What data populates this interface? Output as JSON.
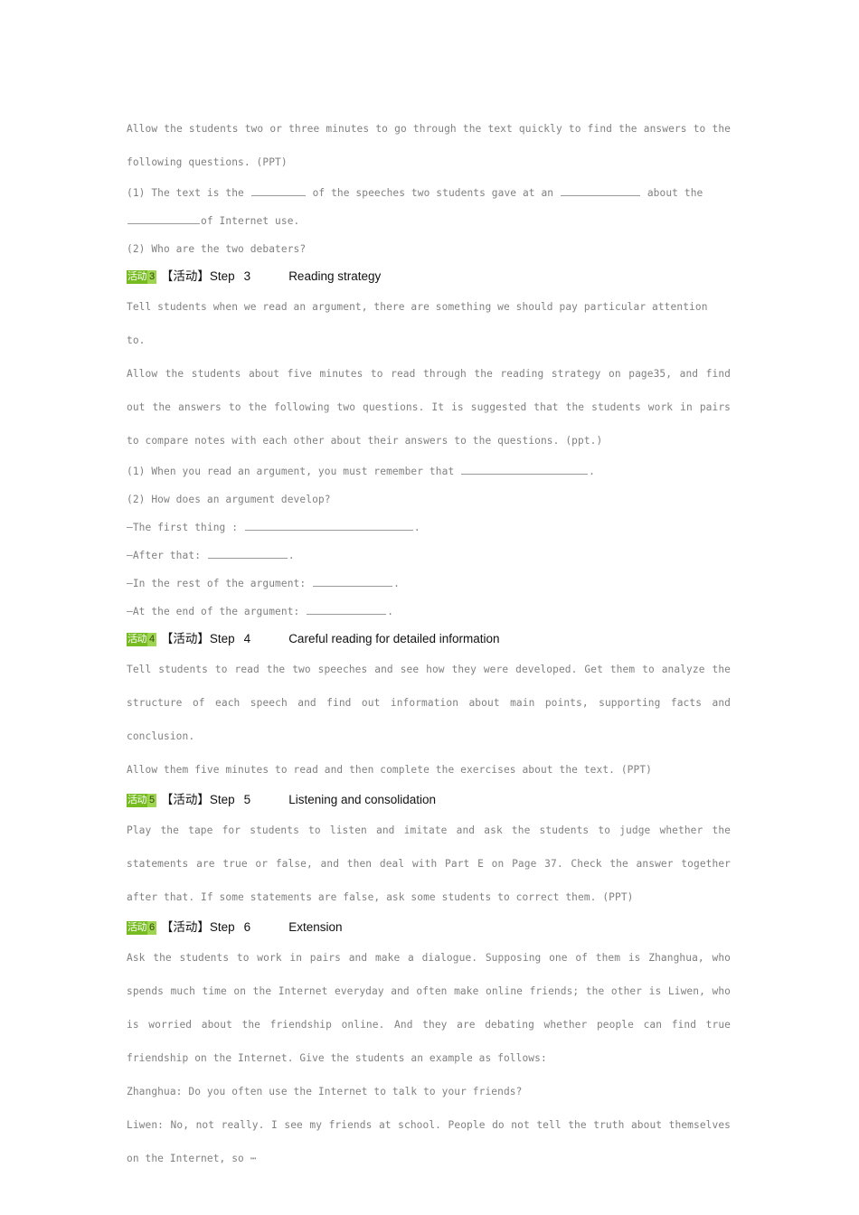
{
  "document": {
    "page_background": "#ffffff",
    "body_text_color": "#808080",
    "heading_text_color": "#111111",
    "badge_color_primary": "#76bc21",
    "badge_color_secondary": "#9ed44f"
  },
  "intro": {
    "p1": "Allow the students two or three minutes to go through the text quickly to find the answers to the following questions. (PPT)",
    "q1_a": "(1) The text is the",
    "q1_b": "of the speeches two students gave at an",
    "q1_c": "about the",
    "q1_d": "of Internet use.",
    "q2": "(2) Who are the two debaters?"
  },
  "steps": [
    {
      "badge_cn": "活动",
      "badge_num": "3",
      "bracket": "【活动】",
      "step_label": "Step",
      "step_num": "3",
      "title": "Reading   strategy",
      "paragraphs": [
        "Tell students when we read an argument, there are something we should pay particular attention to.",
        "Allow the students about five minutes to read through the reading strategy on page35, and find out the answers to the following two questions. It is suggested that the students work in pairs to compare notes with each other about their answers to the questions. (ppt.)"
      ],
      "questions": {
        "q1": "(1) When you read an argument, you must remember that",
        "q1_end": ".",
        "q2": "(2) How does an argument develop?",
        "a1": "—The first thing :",
        "a1_end": ".",
        "a2": "—After that:",
        "a2_end": ".",
        "a3": "—In the rest of the argument:",
        "a3_end": ".",
        "a4": "—At the end of the argument:",
        "a4_end": "."
      }
    },
    {
      "badge_cn": "活动",
      "badge_num": "4",
      "bracket": "【活动】",
      "step_label": "Step",
      "step_num": "4",
      "title": "Careful   reading   for   detailed   information",
      "paragraphs": [
        "Tell students to read the two speeches and see how they were developed. Get them to analyze the structure of each speech and find out information about main points, supporting facts and conclusion.",
        "Allow them five minutes to read and then complete the   exercises about the text. (PPT)"
      ]
    },
    {
      "badge_cn": "活动",
      "badge_num": "5",
      "bracket": "【活动】",
      "step_label": "Step",
      "step_num": "5",
      "title": "Listening   and   consolidation",
      "paragraphs": [
        "Play the tape for students to listen and imitate and ask the students to judge whether the statements are true or false, and then deal with Part E on Page 37. Check the answer together after that. If some statements are false, ask some students to correct them.    (PPT)"
      ]
    },
    {
      "badge_cn": "活动",
      "badge_num": "6",
      "bracket": "【活动】",
      "step_label": "Step",
      "step_num": "6",
      "title": "Extension",
      "paragraphs": [
        "Ask the students to work in pairs and make a dialogue. Supposing one of them is Zhanghua, who spends much time on the Internet everyday and often make online friends; the other is Liwen, who is worried about the friendship online. And they are debating whether people can find true friendship on the Internet. Give the students an example as follows:",
        "Zhanghua: Do you often use the Internet to talk to your friends?",
        "Liwen: No, not really. I see my friends at school. People do not tell the truth about themselves on the Internet, so ⋯"
      ]
    }
  ]
}
